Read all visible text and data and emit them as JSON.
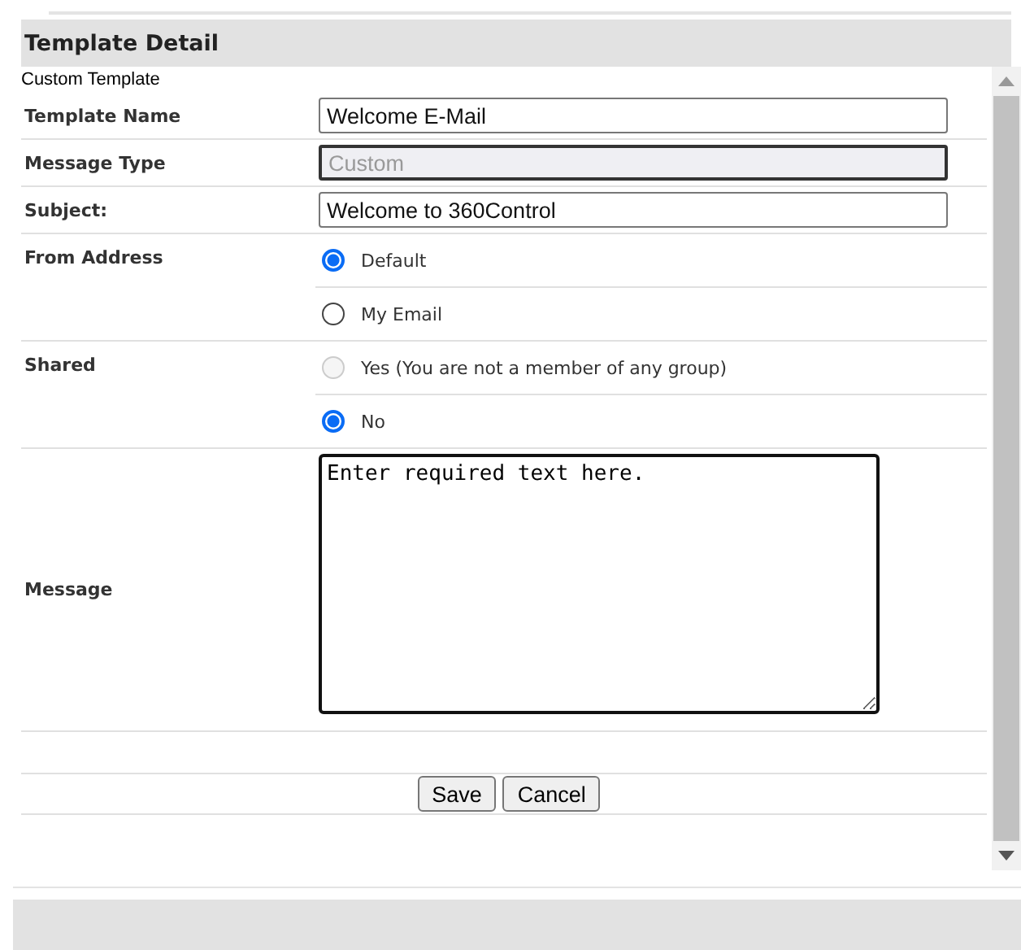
{
  "panel": {
    "title": "Template Detail",
    "subtitle": "Custom Template"
  },
  "fields": [
    {
      "kind": "text",
      "label": "Template Name",
      "value": "Welcome E-Mail",
      "disabled": false
    },
    {
      "kind": "text",
      "label": "Message Type",
      "value": "Custom",
      "disabled": true
    },
    {
      "kind": "text",
      "label": "Subject:",
      "value": "Welcome to 360Control",
      "disabled": false
    },
    {
      "kind": "radio",
      "label": "From Address",
      "options": [
        {
          "label": "Default",
          "selected": true,
          "disabled": false
        },
        {
          "label": "My Email",
          "selected": false,
          "disabled": false
        }
      ]
    },
    {
      "kind": "radio",
      "label": "Shared",
      "options": [
        {
          "label": "Yes (You are not a member of any group)",
          "selected": false,
          "disabled": true
        },
        {
          "label": "No",
          "selected": true,
          "disabled": false
        }
      ]
    },
    {
      "kind": "textarea",
      "label": "Message",
      "value": "Enter required text here."
    }
  ],
  "buttons": [
    "Save",
    "Cancel"
  ]
}
